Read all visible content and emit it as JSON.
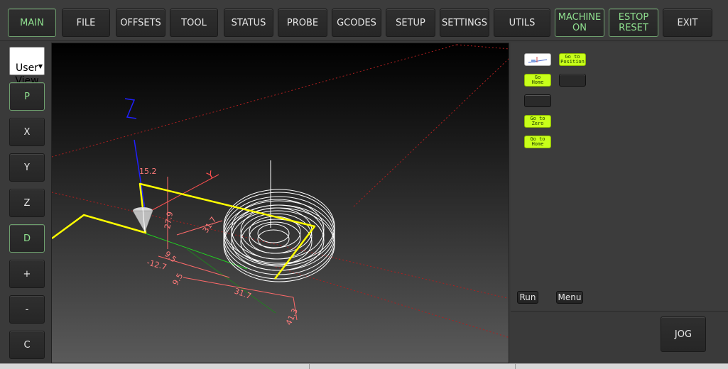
{
  "topbar": {
    "buttons": [
      {
        "label": "MAIN",
        "state": "active"
      },
      {
        "label": "FILE"
      },
      {
        "label": "OFFSETS"
      },
      {
        "label": "TOOL"
      },
      {
        "label": "STATUS"
      },
      {
        "label": "PROBE"
      },
      {
        "label": "GCODES"
      },
      {
        "label": "SETUP"
      },
      {
        "label": "SETTINGS"
      },
      {
        "label": "UTILS"
      },
      {
        "label": "MACHINE\nON",
        "state": "active"
      },
      {
        "label": "ESTOP\nRESET",
        "state": "active"
      },
      {
        "label": "EXIT"
      }
    ]
  },
  "sidebar": {
    "view_select": "User\nView",
    "buttons": [
      "P",
      "X",
      "Y",
      "Z",
      "D",
      "+",
      "-",
      "C"
    ]
  },
  "viewport": {
    "axis_z_label": "Z",
    "axis_y_label": "Y",
    "dimensions": [
      "15.2",
      "27.9",
      "31.7",
      "9.5",
      "-12.7",
      "9.5",
      "31.7",
      "41.3"
    ]
  },
  "right_panel": {
    "mini_buttons": [
      "Go to\nPosition",
      "Go\nHome",
      "Go to\nZero",
      "Go to\nHome"
    ],
    "run_label": "Run",
    "menu_label": "Menu"
  },
  "jog_label": "JOG",
  "colors": {
    "active_text": "#8fe08f",
    "lime": "#c8ff1a",
    "toolpath": "#ffff00",
    "dims": "#ff6a6a",
    "z_axis": "#2020ff"
  }
}
